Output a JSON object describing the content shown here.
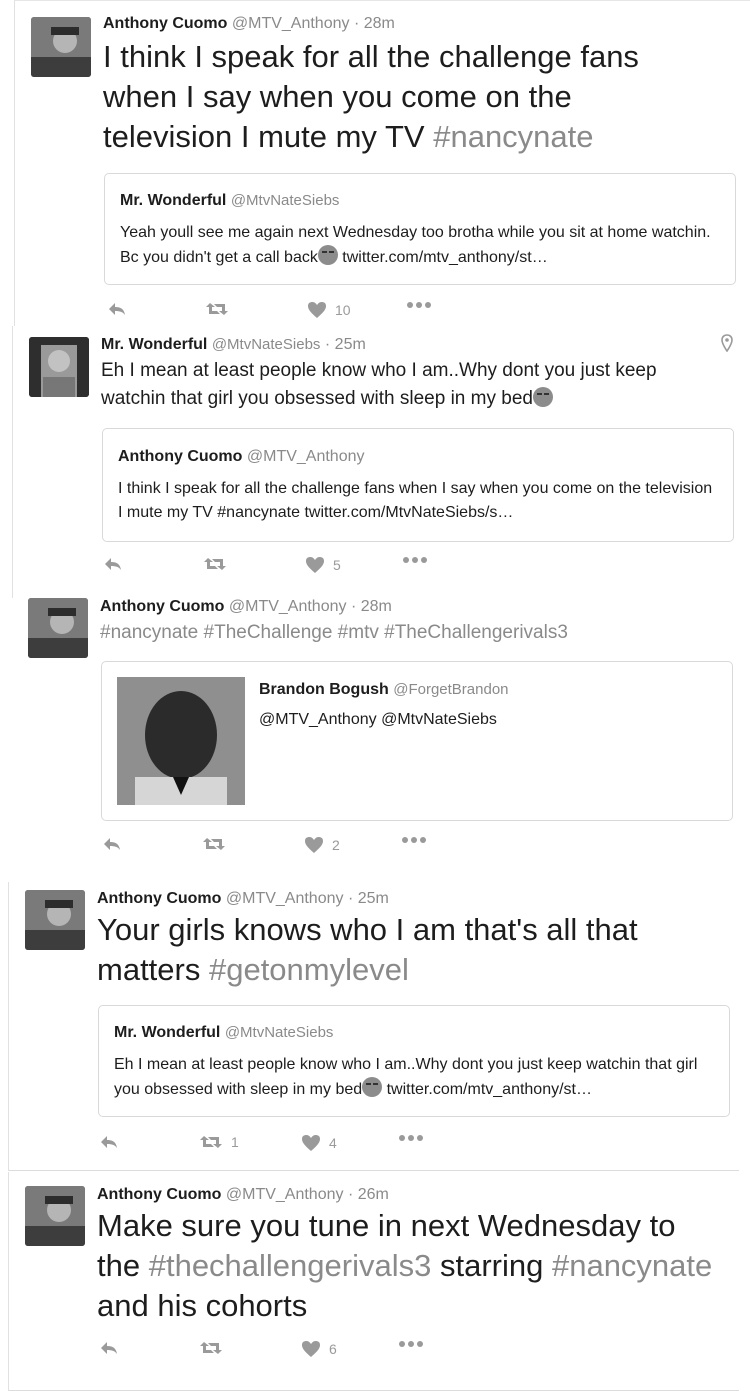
{
  "tweets": [
    {
      "author": "Anthony Cuomo",
      "handle": "@MTV_Anthony",
      "sep": "·",
      "time": "28m",
      "text_parts": [
        "I think I speak for all the challenge fans when I say when you come on the television I mute my TV ",
        "#nancynate"
      ],
      "quote": {
        "author": "Mr. Wonderful",
        "handle": "@MtvNateSiebs",
        "text_a": "Yeah youll see me again next Wednesday too brotha  while you sit at home watchin. Bc you didn't get a call back",
        "text_b": " twitter.com/mtv_anthony/st…"
      },
      "likes": "10"
    },
    {
      "author": "Mr. Wonderful",
      "handle": "@MtvNateSiebs",
      "sep": "·",
      "time": "25m",
      "text": "Eh I mean at least people know who I am..Why dont you just keep watchin that girl you obsessed with sleep in my bed",
      "quote": {
        "author": "Anthony Cuomo",
        "handle": "@MTV_Anthony",
        "text": "I think I speak for all the challenge fans when I say when you come on the television I mute my TV #nancynate twitter.com/MtvNateSiebs/s…"
      },
      "likes": "5"
    },
    {
      "author": "Anthony Cuomo",
      "handle": "@MTV_Anthony",
      "sep": "·",
      "time": "28m",
      "text": "#nancynate #TheChallenge #mtv #TheChallengerivals3",
      "quote": {
        "author": "Brandon Bogush",
        "handle": "@ForgetBrandon",
        "text": "@MTV_Anthony @MtvNateSiebs"
      },
      "likes": "2"
    },
    {
      "author": "Anthony Cuomo",
      "handle": "@MTV_Anthony",
      "sep": "·",
      "time": "25m",
      "text_parts": [
        "Your girls knows who I am that's all that matters ",
        "#getonmylevel"
      ],
      "quote": {
        "author": "Mr. Wonderful",
        "handle": "@MtvNateSiebs",
        "text_a": "Eh I mean at least people know who I am..Why dont you just keep watchin that girl you obsessed with sleep in my bed",
        "text_b": " twitter.com/mtv_anthony/st…"
      },
      "retweets": "1",
      "likes": "4"
    },
    {
      "author": "Anthony Cuomo",
      "handle": "@MTV_Anthony",
      "sep": "·",
      "time": "26m",
      "text_parts": [
        "Make sure you tune in next Wednesday to the ",
        "#thechallengerivals3",
        " starring ",
        "#nancynate",
        " and his cohorts"
      ],
      "likes": "6"
    }
  ],
  "icons": [
    "reply-icon",
    "retweet-icon",
    "heart-icon",
    "more-icon",
    "location-pin-icon"
  ],
  "colors": {
    "text": "#1d1d1d",
    "muted": "#8a8a8a",
    "hashtag": "#8a8a8a",
    "border": "#d9d9d9"
  }
}
